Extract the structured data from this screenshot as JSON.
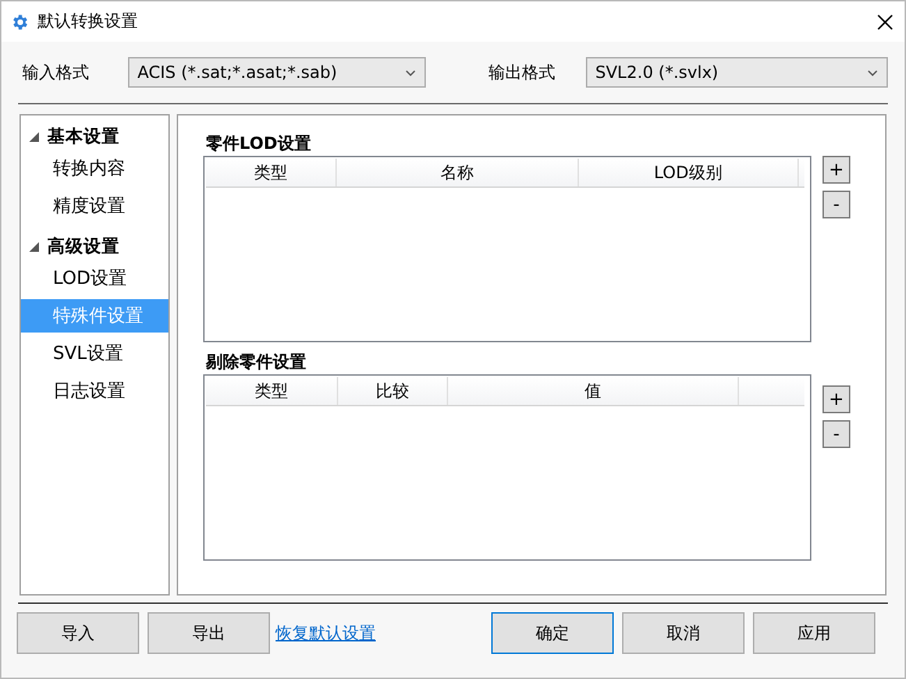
{
  "window": {
    "title": "默认转换设置"
  },
  "formats": [
    {
      "label": "输入格式",
      "value": "ACIS (*.sat;*.asat;*.sab)"
    },
    {
      "label": "输出格式",
      "value": "SVL2.0 (*.svlx)"
    }
  ],
  "sidebar": {
    "groups": [
      {
        "label": "基本设置",
        "expanded": true,
        "children": [
          {
            "label": "转换内容",
            "selected": false
          },
          {
            "label": "精度设置",
            "selected": false
          }
        ]
      },
      {
        "label": "高级设置",
        "expanded": true,
        "children": [
          {
            "label": "LOD设置",
            "selected": false
          },
          {
            "label": "特殊件设置",
            "selected": true
          },
          {
            "label": "SVL设置",
            "selected": false
          },
          {
            "label": "日志设置",
            "selected": false
          }
        ]
      }
    ]
  },
  "sections": [
    {
      "title": "零件LOD设置",
      "columns": [
        "类型",
        "名称",
        "LOD级别"
      ],
      "buttons": [
        "+",
        "-"
      ]
    },
    {
      "title": "剔除零件设置",
      "columns": [
        "类型",
        "比较",
        "值"
      ],
      "buttons": [
        "+",
        "-"
      ]
    }
  ],
  "footer": {
    "left_buttons": [
      "导入",
      "导出"
    ],
    "link": "恢复默认设置",
    "right_buttons": [
      {
        "label": "确定",
        "default": true
      },
      {
        "label": "取消",
        "default": false
      },
      {
        "label": "应用",
        "default": false
      }
    ]
  }
}
